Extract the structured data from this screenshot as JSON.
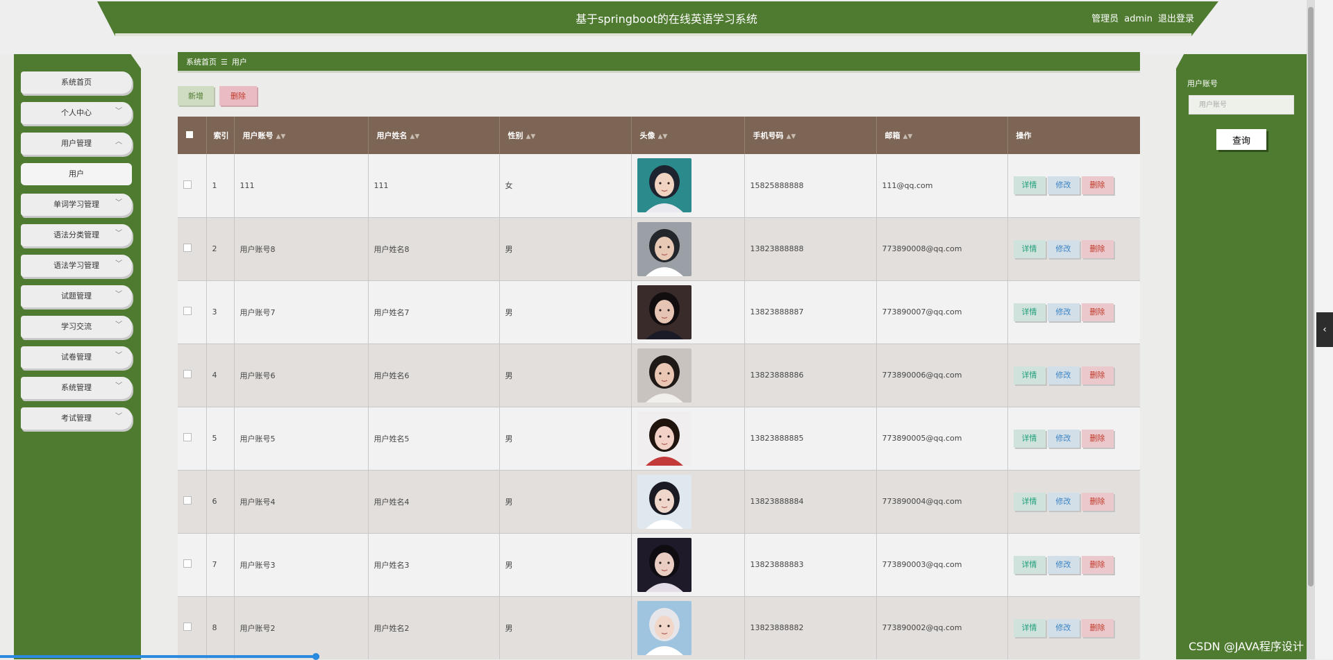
{
  "header": {
    "title": "基于springboot的在线英语学习系统",
    "role": "管理员",
    "username": "admin",
    "logout": "退出登录"
  },
  "sidebar": {
    "items": [
      {
        "label": "系统首页",
        "chevron": false
      },
      {
        "label": "个人中心",
        "chevron": true,
        "dir": "down"
      },
      {
        "label": "用户管理",
        "chevron": true,
        "dir": "up"
      },
      {
        "label": "用户",
        "chevron": false,
        "sub": true
      },
      {
        "label": "单词学习管理",
        "chevron": true,
        "dir": "down"
      },
      {
        "label": "语法分类管理",
        "chevron": true,
        "dir": "down"
      },
      {
        "label": "语法学习管理",
        "chevron": true,
        "dir": "down"
      },
      {
        "label": "试题管理",
        "chevron": true,
        "dir": "down"
      },
      {
        "label": "学习交流",
        "chevron": true,
        "dir": "down"
      },
      {
        "label": "试卷管理",
        "chevron": true,
        "dir": "down"
      },
      {
        "label": "系统管理",
        "chevron": true,
        "dir": "down"
      },
      {
        "label": "考试管理",
        "chevron": true,
        "dir": "down"
      }
    ]
  },
  "breadcrumb": {
    "home": "系统首页",
    "separator": "☰",
    "current": "用户"
  },
  "toolbar": {
    "add_label": "新增",
    "delete_label": "删除"
  },
  "search": {
    "label": "用户账号",
    "placeholder": "用户账号",
    "button": "查询"
  },
  "table": {
    "columns": [
      "索引",
      "用户账号",
      "用户姓名",
      "性别",
      "头像",
      "手机号码",
      "邮箱",
      "操作"
    ],
    "rows": [
      {
        "index": "1",
        "account": "111",
        "name": "111",
        "gender": "女",
        "phone": "15825888888",
        "email": "111@qq.com"
      },
      {
        "index": "2",
        "account": "用户账号8",
        "name": "用户姓名8",
        "gender": "男",
        "phone": "13823888888",
        "email": "773890008@qq.com"
      },
      {
        "index": "3",
        "account": "用户账号7",
        "name": "用户姓名7",
        "gender": "男",
        "phone": "13823888887",
        "email": "773890007@qq.com"
      },
      {
        "index": "4",
        "account": "用户账号6",
        "name": "用户姓名6",
        "gender": "男",
        "phone": "13823888886",
        "email": "773890006@qq.com"
      },
      {
        "index": "5",
        "account": "用户账号5",
        "name": "用户姓名5",
        "gender": "男",
        "phone": "13823888885",
        "email": "773890005@qq.com"
      },
      {
        "index": "6",
        "account": "用户账号4",
        "name": "用户姓名4",
        "gender": "男",
        "phone": "13823888884",
        "email": "773890004@qq.com"
      },
      {
        "index": "7",
        "account": "用户账号3",
        "name": "用户姓名3",
        "gender": "男",
        "phone": "13823888883",
        "email": "773890003@qq.com"
      },
      {
        "index": "8",
        "account": "用户账号2",
        "name": "用户姓名2",
        "gender": "男",
        "phone": "13823888882",
        "email": "773890002@qq.com"
      }
    ],
    "actions": {
      "detail": "详情",
      "edit": "修改",
      "delete": "删除"
    }
  },
  "watermark": "CSDN @JAVA程序设计",
  "colors": {
    "primary": "#4e7b30",
    "table_header": "#7d6555",
    "detail": "#1e9e7a",
    "edit": "#3a83c5",
    "danger": "#c0392b"
  }
}
